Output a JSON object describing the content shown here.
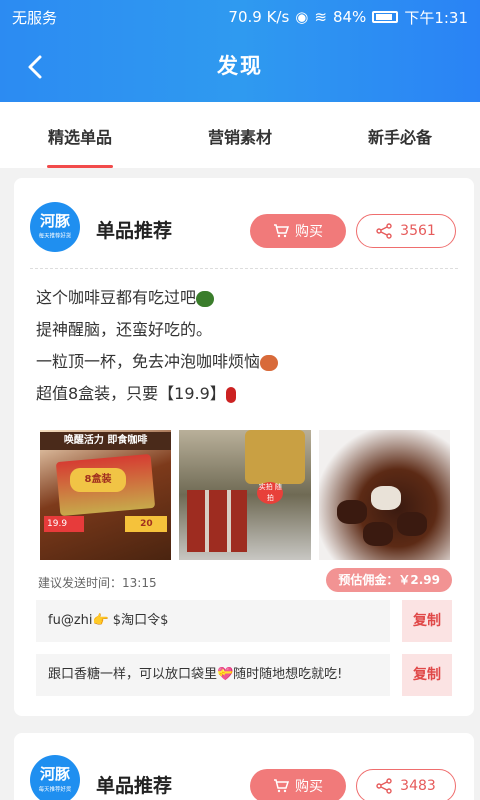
{
  "status_bar": {
    "carrier": "无服务",
    "speed": "70.9 K/s",
    "battery": "84%",
    "time": "下午1:31"
  },
  "header": {
    "title": "发现"
  },
  "tabs": [
    {
      "label": "精选单品",
      "active": true
    },
    {
      "label": "营销素材",
      "active": false
    },
    {
      "label": "新手必备",
      "active": false
    }
  ],
  "cards": [
    {
      "avatar": {
        "name": "河豚",
        "sub": "每天推荐好货"
      },
      "title": "单品推荐",
      "buy_label": "购买",
      "share_count": "3561",
      "desc": [
        "这个咖啡豆都有吃过吧",
        "提神醒脑，还蛮好吃的。",
        "一粒顶一杯，免去冲泡咖啡烦恼",
        "超值8盒装，只要【19.9】"
      ],
      "photo1": {
        "banner": "唤醒活力 即食咖啡",
        "label": "8盒装",
        "price": "19.9",
        "price_tag": "20"
      },
      "photo2": {
        "tag": "实拍 随拍"
      },
      "send_time": "建议发送时间：13:15",
      "commission": "预估佣金：￥2.99",
      "copy_rows": [
        {
          "text": "fu@zhi👉 $淘口令$",
          "button": "复制"
        },
        {
          "text": "跟口香糖一样，可以放口袋里💝随时随地想吃就吃!",
          "button": "复制"
        }
      ]
    },
    {
      "avatar": {
        "name": "河豚",
        "sub": "每天推荐好货"
      },
      "title": "单品推荐",
      "buy_label": "购买",
      "share_count": "3483"
    }
  ],
  "colors": {
    "header_blue": "#2c8bf2",
    "accent_red": "#f24b4b",
    "buy_button": "#f17a7a"
  }
}
